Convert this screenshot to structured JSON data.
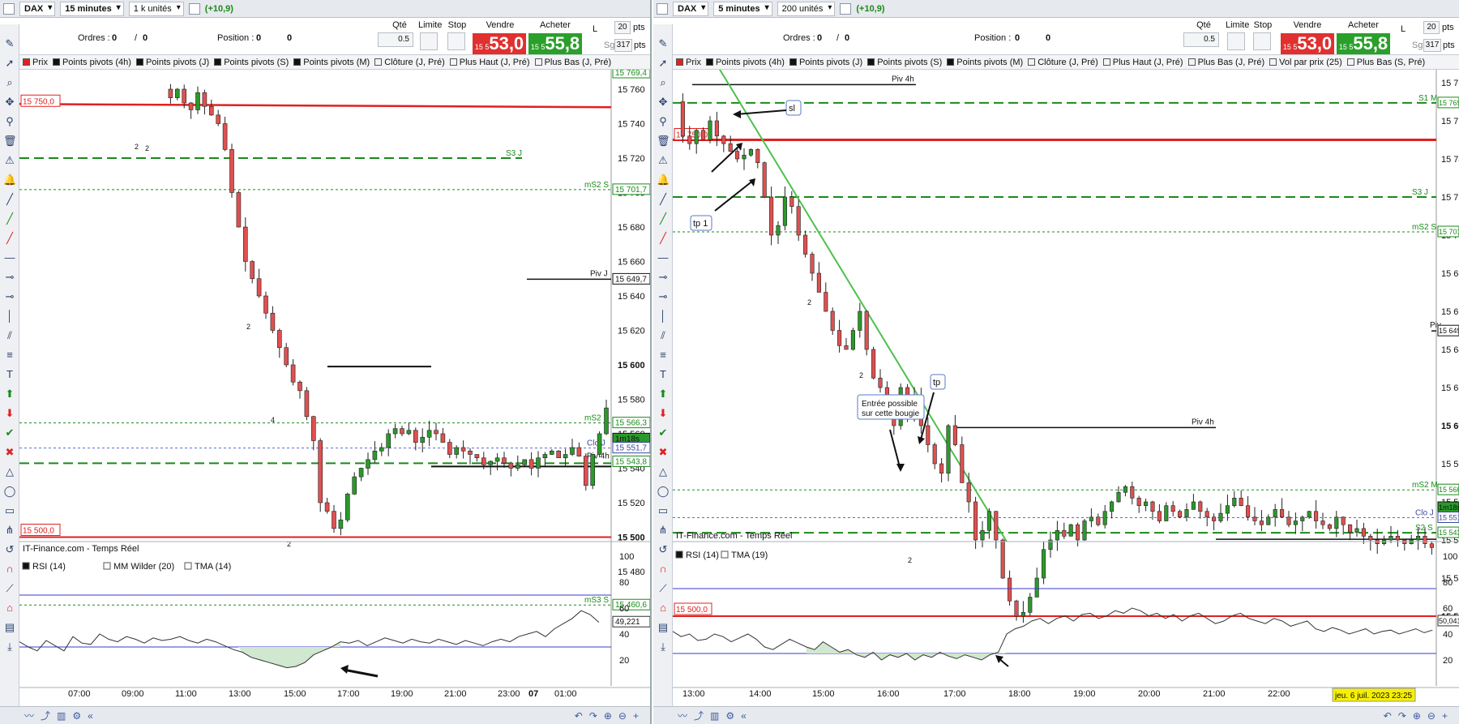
{
  "left": {
    "instrument": "DAX",
    "timeframe": "15 minutes",
    "units": "1 k unités",
    "variation": "(+10,9)",
    "orders_label": "Ordres :",
    "orders_value": "0",
    "orders_sep": "/",
    "orders_value2": "0",
    "position_label": "Position :",
    "position_value": "0",
    "position_value2": "0",
    "qty_label": "Qté",
    "qty_value": "0.5",
    "limit_label": "Limite",
    "stop_label": "Stop",
    "sell_label": "Vendre",
    "buy_label": "Acheter",
    "sell_prefix": "15 5",
    "sell_big": "53,0",
    "buy_prefix": "15 5",
    "buy_big": "55,8",
    "chk_l": "L",
    "chk_sg": "Sg",
    "pts1_value": "20",
    "pts2_value": "317",
    "pts_label": "pts",
    "indicators": [
      "Prix",
      "Points pivots (4h)",
      "Points pivots (J)",
      "Points pivots (S)",
      "Points pivots (M)",
      "Clôture (J, Pré)",
      "Plus Haut (J, Pré)",
      "Plus Bas (J, Pré)"
    ],
    "source": "IT-Finance.com - Temps Réel",
    "rsi_indicators": [
      "RSI (14)",
      "MM Wilder (20)",
      "TMA (14)"
    ],
    "rsi_value": "49,221",
    "price_axis": [
      "15 760",
      "15 740",
      "15 720",
      "15 700",
      "15 680",
      "15 660",
      "15 640",
      "15 620",
      "15 600",
      "15 580",
      "15 560",
      "15 540",
      "15 520",
      "15 500",
      "15 480",
      "15 460"
    ],
    "rsi_axis": [
      "100",
      "80",
      "60",
      "40",
      "20"
    ],
    "time_axis": [
      "07:00",
      "09:00",
      "11:00",
      "13:00",
      "15:00",
      "17:00",
      "19:00",
      "21:00",
      "23:00",
      "07",
      "01:00"
    ],
    "level_tags": [
      {
        "text": "15 769,4",
        "color": "#1a8a1a"
      },
      {
        "text": "15 701,7",
        "color": "#1a8a1a"
      },
      {
        "text": "15 649,7",
        "color": "#111111"
      },
      {
        "text": "15 566,3",
        "color": "#1a8a1a"
      },
      {
        "text": "1m18s",
        "color": "#111111"
      },
      {
        "text": "15 551,7",
        "color": "#3a4aa0"
      },
      {
        "text": "15 543,8",
        "color": "#1a8a1a"
      },
      {
        "text": "15 460,6",
        "color": "#1a8a1a"
      }
    ],
    "labels": {
      "s3j": "S3 J",
      "ms2s": "mS2 S",
      "pivj": "Piv J",
      "ms2": "mS2",
      "cloj": "Clo J",
      "piv4h": "Piv 4h",
      "ms3s": "mS3 S",
      "p15750": "15 750,0",
      "p15500": "15 500,0"
    },
    "pivot_markers": [
      "2",
      "2",
      "2",
      "4",
      "2"
    ]
  },
  "right": {
    "instrument": "DAX",
    "timeframe": "5 minutes",
    "units": "200 unités",
    "variation": "(+10,9)",
    "orders_label": "Ordres :",
    "orders_value": "0",
    "orders_sep": "/",
    "orders_value2": "0",
    "position_label": "Position :",
    "position_value": "0",
    "position_value2": "0",
    "qty_label": "Qté",
    "qty_value": "0.5",
    "limit_label": "Limite",
    "stop_label": "Stop",
    "sell_label": "Vendre",
    "buy_label": "Acheter",
    "sell_prefix": "15 5",
    "sell_big": "53,0",
    "buy_prefix": "15 5",
    "buy_big": "55,8",
    "chk_l": "L",
    "chk_sg": "Sg",
    "pts1_value": "20",
    "pts2_value": "317",
    "pts_label": "pts",
    "indicators": [
      "Prix",
      "Points pivots (4h)",
      "Points pivots (J)",
      "Points pivots (S)",
      "Points pivots (M)",
      "Clôture (J, Pré)",
      "Plus Haut (J, Pré)",
      "Plus Bas (J, Pré)",
      "Vol par prix (25)",
      "Plus Bas (S, Pré)"
    ],
    "source": "IT-Finance.com - Temps Réel",
    "rsi_indicators": [
      "RSI (14)",
      "TMA (19)"
    ],
    "rsi_value": "50,041",
    "price_axis": [
      "15 780",
      "15 760",
      "15 740",
      "15 720",
      "15 700",
      "15 680",
      "15 660",
      "15 640",
      "15 620",
      "15 600",
      "15 580",
      "15 560",
      "15 540",
      "15 520",
      "15 500"
    ],
    "rsi_axis": [
      "100",
      "80",
      "60",
      "40",
      "20"
    ],
    "time_axis": [
      "13:00",
      "14:00",
      "15:00",
      "16:00",
      "17:00",
      "18:00",
      "19:00",
      "20:00",
      "21:00",
      "22:00"
    ],
    "date_badge": "jeu. 6 juil. 2023 23:25",
    "level_tags": [
      {
        "text": "15 769,4",
        "color": "#1a8a1a"
      },
      {
        "text": "15 701,7",
        "color": "#1a8a1a"
      },
      {
        "text": "15 649,7",
        "color": "#111111"
      },
      {
        "text": "15 566,3",
        "color": "#1a8a1a"
      },
      {
        "text": "1m18s",
        "color": "#111111"
      },
      {
        "text": "15 551,7",
        "color": "#3a4aa0"
      },
      {
        "text": "15 543,8",
        "color": "#1a8a1a"
      }
    ],
    "labels": {
      "piv4h_top": "Piv 4h",
      "s1m": "S1 M",
      "s3j": "S3 J",
      "ms2s": "mS2 S",
      "piv4h_mid": "Piv 4h",
      "ms2m": "mS2 M",
      "cloj": "Clo J",
      "s2s": "S2 S",
      "pivr": "Piv",
      "p15750": "15 750,0",
      "p15500": "15 500,0"
    },
    "annotations": {
      "sl": "sl",
      "tp1": "tp 1",
      "tp": "tp",
      "entry_line1": "Entrée possible",
      "entry_line2": "sur cette bougie"
    },
    "pivot_markers": [
      "2",
      "2",
      "2",
      "2"
    ]
  },
  "colors": {
    "up": "#2a9a2a",
    "down": "#e05050",
    "pivot_green": "#1a8a1a",
    "red_line": "#e02020",
    "rsi_line": "#3a3ad0",
    "trend": "#4ec04e"
  }
}
